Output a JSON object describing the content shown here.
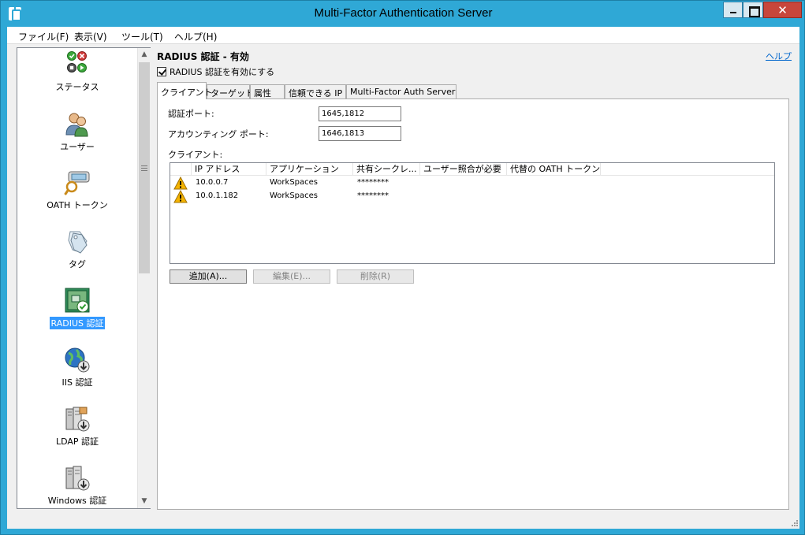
{
  "window": {
    "title": "Multi-Factor Authentication Server"
  },
  "menu": [
    {
      "label": "ファイル(F)"
    },
    {
      "label": "表示(V)"
    },
    {
      "label": "ツール(T)"
    },
    {
      "label": "ヘルプ(H)"
    }
  ],
  "sidebar": {
    "items": [
      {
        "label": "ステータス",
        "icon": "status-icon"
      },
      {
        "label": "ユーザー",
        "icon": "users-icon"
      },
      {
        "label": "OATH トークン",
        "icon": "oath-token-icon"
      },
      {
        "label": "タグ",
        "icon": "tag-icon"
      },
      {
        "label": "RADIUS 認証",
        "icon": "radius-icon",
        "selected": true
      },
      {
        "label": "IIS 認証",
        "icon": "iis-globe-icon"
      },
      {
        "label": "LDAP 認証",
        "icon": "ldap-server-icon"
      },
      {
        "label": "Windows 認証",
        "icon": "windows-server-icon"
      }
    ]
  },
  "main": {
    "title": "RADIUS 認証 - 有効",
    "help_link": "ヘルプ",
    "enable_checkbox": {
      "label": "RADIUS 認証を有効にする",
      "checked": true
    },
    "tabs": [
      {
        "label": "クライアント",
        "active": true
      },
      {
        "label": "ターゲット"
      },
      {
        "label": "属性"
      },
      {
        "label": "信頼できる IP"
      },
      {
        "label": "Multi-Factor Auth Server"
      }
    ],
    "auth_port": {
      "label": "認証ポート:",
      "value": "1645,1812"
    },
    "accounting_port": {
      "label": "アカウンティング ポート:",
      "value": "1646,1813"
    },
    "clients_label": "クライアント:",
    "clients_table": {
      "columns": [
        "",
        "IP アドレス",
        "アプリケーション",
        "共有シークレ...",
        "ユーザー照合が必要",
        "代替の OATH トークン"
      ],
      "rows": [
        {
          "icon": "warning-icon",
          "ip": "10.0.0.7",
          "application": "WorkSpaces",
          "secret": "********"
        },
        {
          "icon": "warning-icon",
          "ip": "10.0.1.182",
          "application": "WorkSpaces",
          "secret": "********"
        }
      ]
    },
    "buttons": {
      "add": "追加(A)...",
      "edit": "編集(E)...",
      "delete": "削除(R)"
    }
  },
  "colors": {
    "frame": "#2fa8d6",
    "selection": "#3399ff",
    "close": "#c7463b"
  }
}
